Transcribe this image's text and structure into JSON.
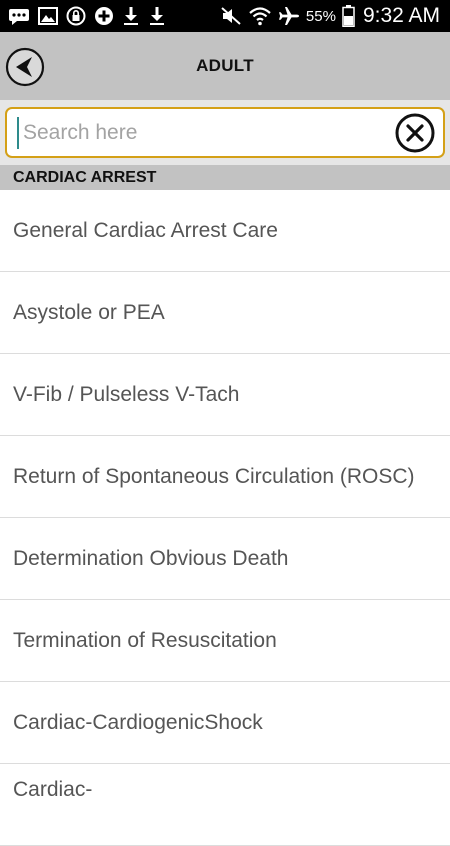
{
  "status_bar": {
    "battery_percent": "55%",
    "time": "9:32 AM"
  },
  "header": {
    "title": "ADULT"
  },
  "search": {
    "placeholder": "Search here",
    "value": ""
  },
  "section": {
    "title": "CARDIAC ARREST"
  },
  "items": [
    {
      "label": "General Cardiac Arrest Care"
    },
    {
      "label": "Asystole or PEA"
    },
    {
      "label": "V-Fib / Pulseless V-Tach"
    },
    {
      "label": "Return of Spontaneous Circulation (ROSC)"
    },
    {
      "label": "Determination Obvious Death"
    },
    {
      "label": "Termination of Resuscitation"
    },
    {
      "label": "Cardiac-CardiogenicShock"
    },
    {
      "label": "Cardiac-"
    }
  ]
}
